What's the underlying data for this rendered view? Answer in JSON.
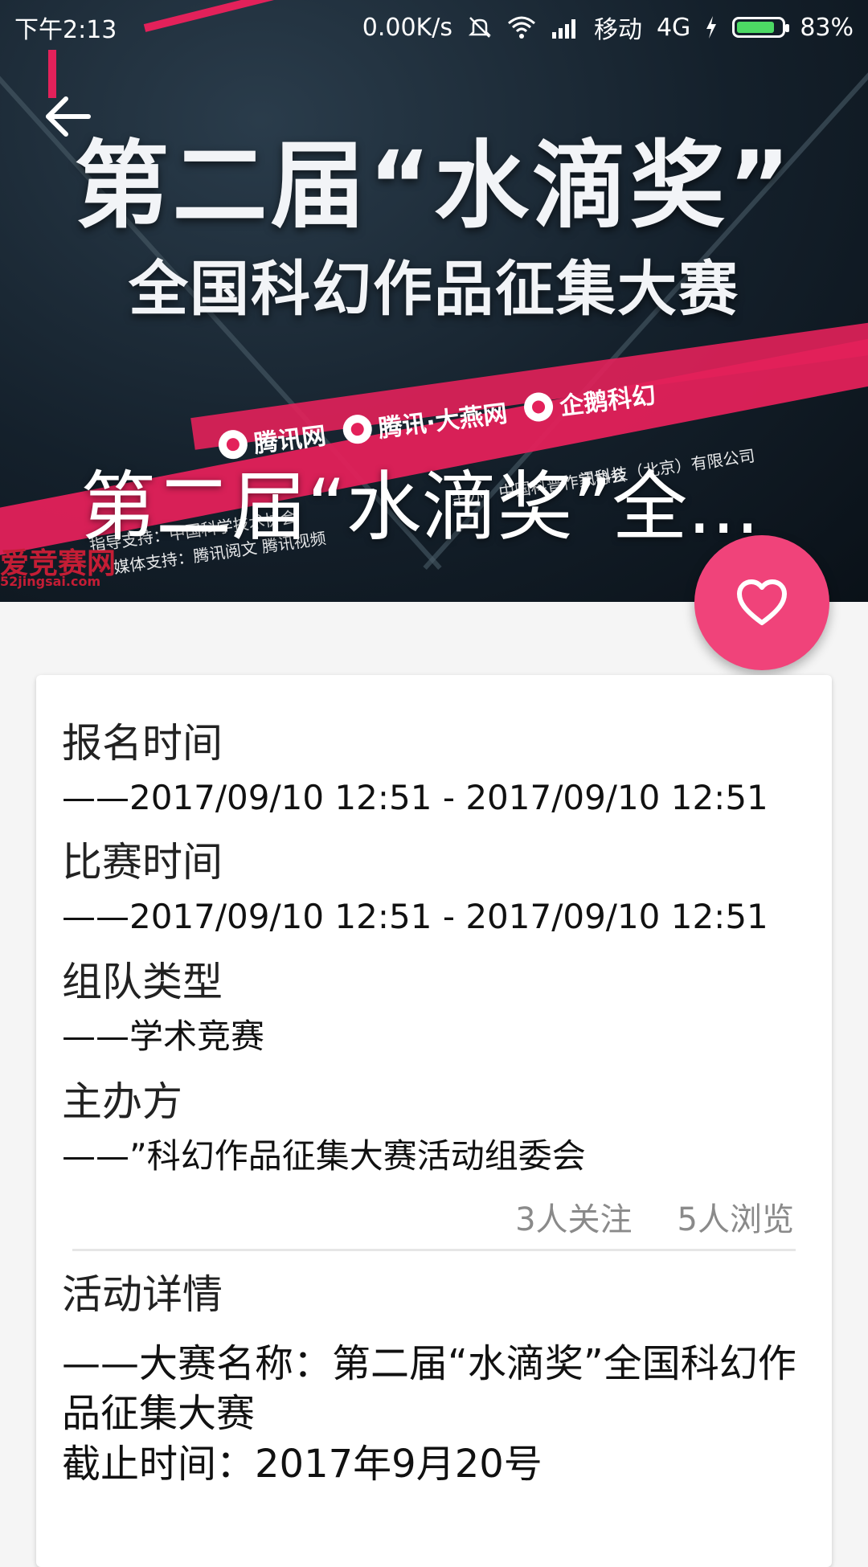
{
  "status_bar": {
    "time": "下午2:13",
    "network_speed": "0.00K/s",
    "carrier": "移动",
    "network_type": "4G",
    "battery": "83%"
  },
  "banner": {
    "poster_line1": "第二届“水滴奖”",
    "poster_line2": "全国科幻作品征集大赛",
    "sponsors": [
      "腾讯网",
      "腾讯·大燕网",
      "企鹅科幻"
    ],
    "support_lines": [
      "指导支持：中国科学技术协会",
      "媒体支持：腾讯阅文 腾讯视频",
      "主办：中国科普作家协会",
      "讯科技（北京）有限公司"
    ],
    "watermark": "爱竞赛网",
    "watermark_sub": "52jingsai.com",
    "title": "第二届“水滴奖”全..."
  },
  "colors": {
    "accent": "#f0437a",
    "stripe": "#e3215a"
  },
  "details": {
    "signup_label": "报名时间",
    "signup_value": "——2017/09/10 12:51 - 2017/09/10 12:51",
    "match_label": "比赛时间",
    "match_value": "——2017/09/10 12:51 - 2017/09/10 12:51",
    "team_label": "组队类型",
    "team_value": "——学术竞赛",
    "organizer_label": "主办方",
    "organizer_value": "——”科幻作品征集大赛活动组委会",
    "follow_count": "3人关注",
    "view_count": "5人浏览",
    "activity_label": "活动详情",
    "activity_line1": "——大赛名称：第二届“水滴奖”全国科幻作品征集大赛",
    "activity_line2": "截止时间：2017年9月20号"
  },
  "icons": {
    "back": "arrow-left-icon",
    "favorite": "heart-icon"
  }
}
